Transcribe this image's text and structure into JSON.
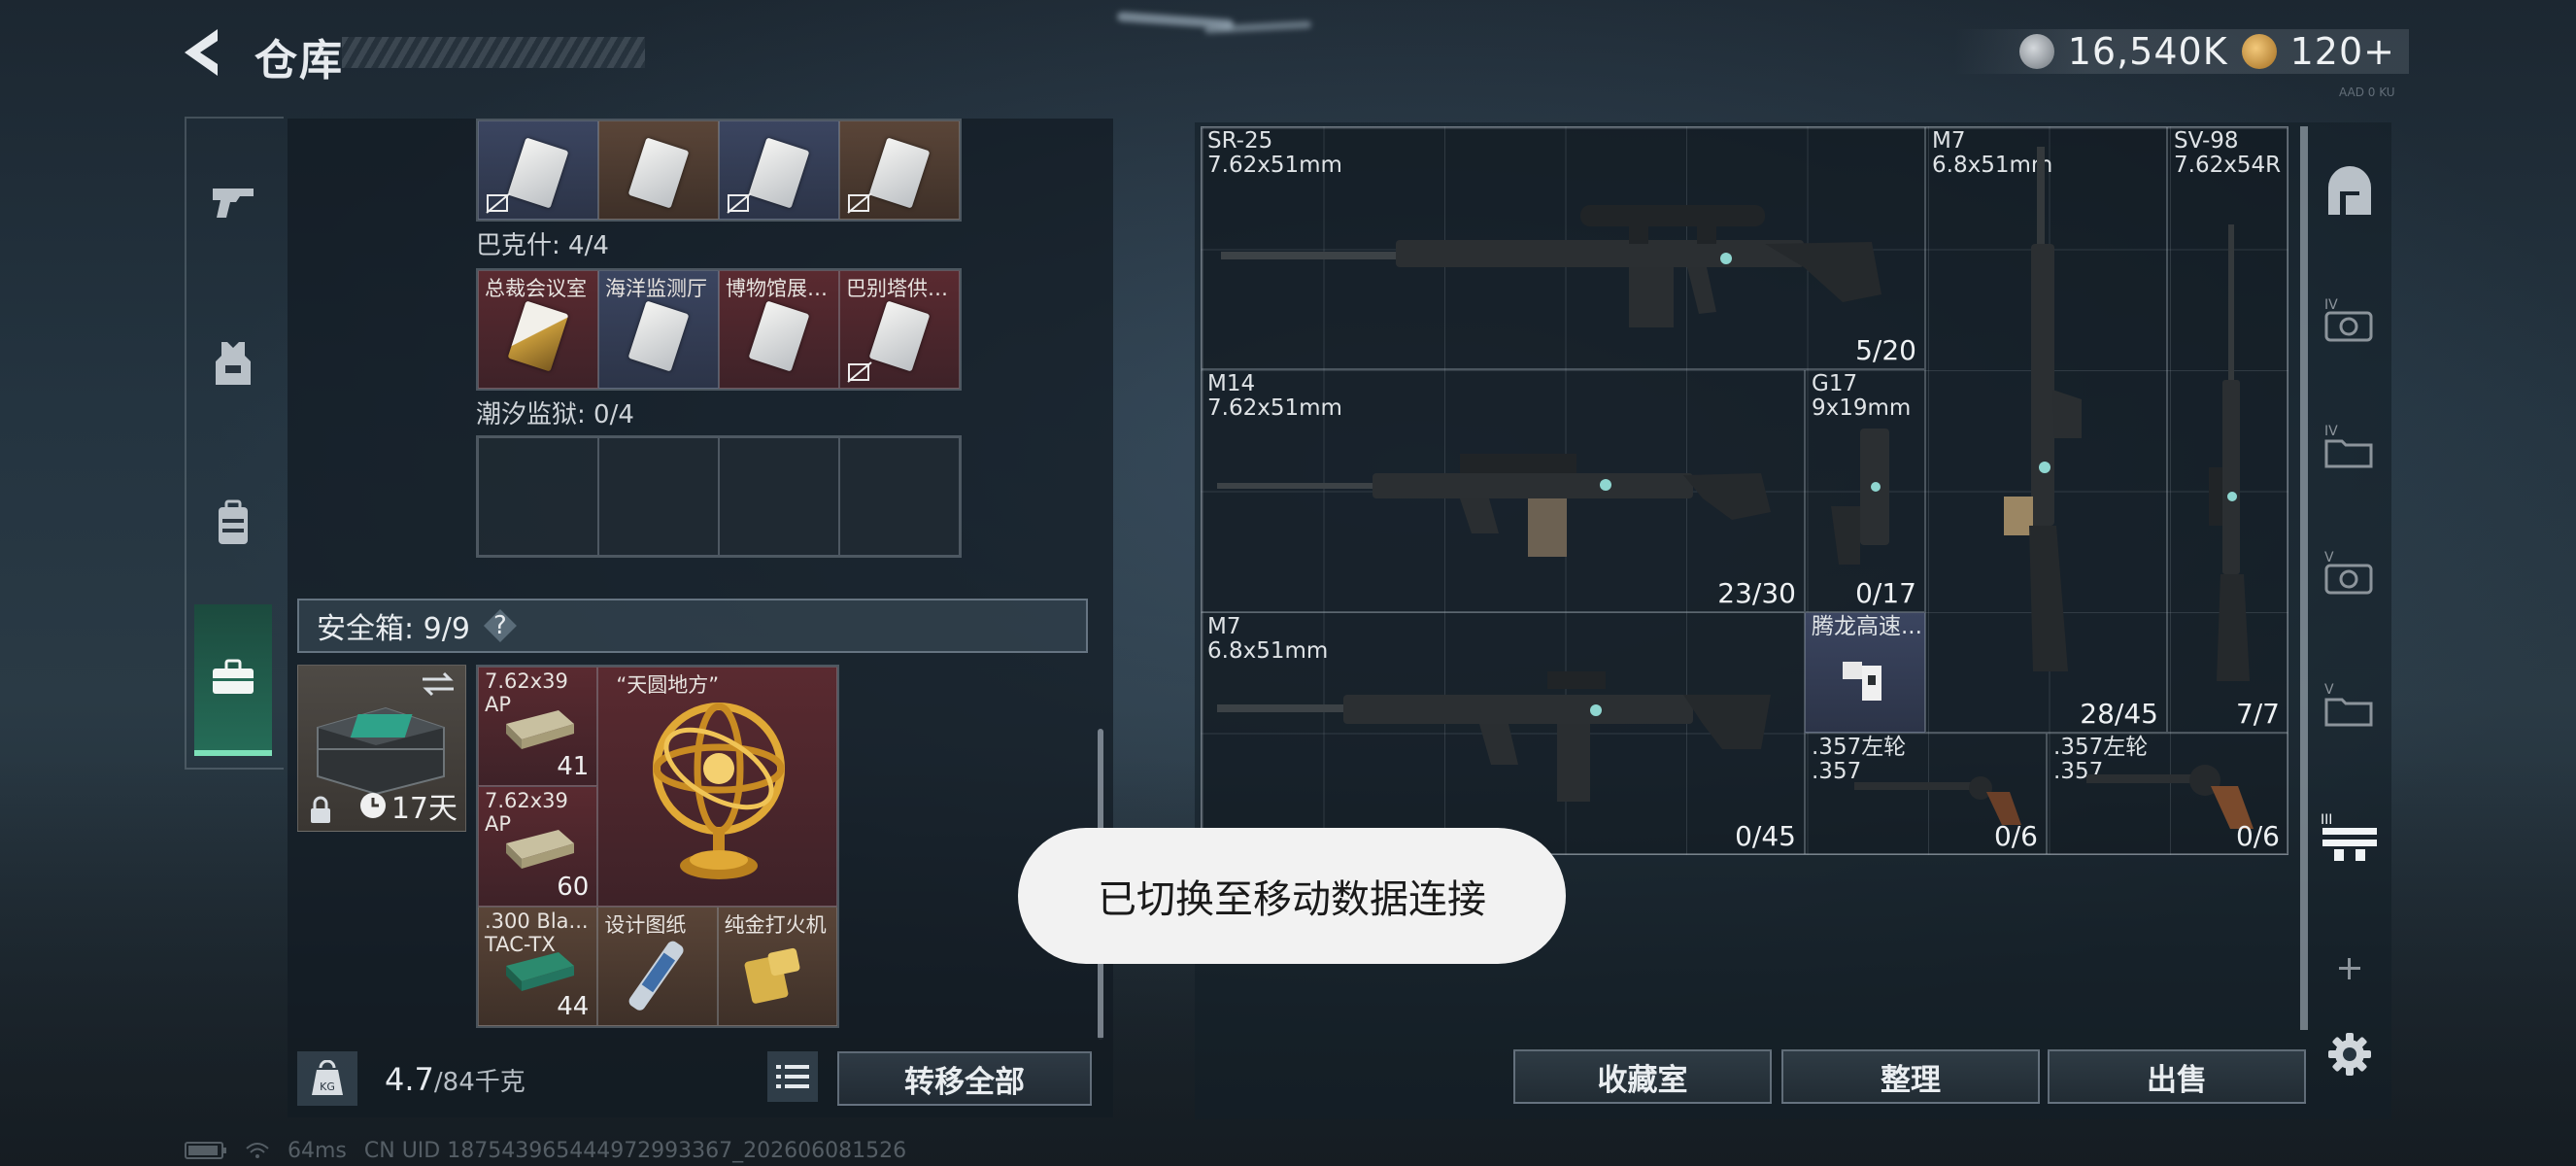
{
  "header": {
    "title": "仓库",
    "currency_silver": "16,540K",
    "currency_gold": "120+",
    "tiny_code": "AAD 0 KU"
  },
  "collection": {
    "row_top_cards": [
      {
        "label": "",
        "color": "blue",
        "nosell": true
      },
      {
        "label": "",
        "color": "brown",
        "nosell": false
      },
      {
        "label": "",
        "color": "blue",
        "nosell": true
      },
      {
        "label": "",
        "color": "brown",
        "nosell": true
      }
    ],
    "set1_label": "巴克什: 4/4",
    "set1_cards": [
      {
        "label": "总裁会议室",
        "color": "red",
        "gold": true,
        "nosell": false
      },
      {
        "label": "海洋监测厅",
        "color": "blue",
        "gold": false,
        "nosell": false
      },
      {
        "label": "博物馆展…",
        "color": "red",
        "gold": false,
        "nosell": false
      },
      {
        "label": "巴别塔供…",
        "color": "red",
        "gold": false,
        "nosell": true
      }
    ],
    "set2_label": "潮汐监狱: 0/4"
  },
  "safe": {
    "header_label": "安全箱: 9/9",
    "help": "?",
    "days_left": "17天",
    "items": [
      {
        "label": "7.62x39\nAP",
        "count": "41"
      },
      {
        "label": "7.62x39\nAP",
        "count": "60"
      },
      {
        "label": "“天圆地方”",
        "count": ""
      },
      {
        "label": ".300 Bla...\nTAC-TX",
        "count": "44"
      },
      {
        "label": "设计图纸",
        "count": ""
      },
      {
        "label": "纯金打火机",
        "count": ""
      }
    ]
  },
  "footer_left": {
    "weight_current": "4.7",
    "weight_max": "/84千克",
    "transfer_all": "转移全部"
  },
  "weapons": [
    {
      "name": "SR-25\n7.62x51mm",
      "ammo": "5/20"
    },
    {
      "name": "M7\n6.8x51mm",
      "ammo": "28/45"
    },
    {
      "name": "SV-98\n7.62x54R",
      "ammo": "7/7"
    },
    {
      "name": "M14\n7.62x51mm",
      "ammo": "23/30"
    },
    {
      "name": "G17\n9x19mm",
      "ammo": "0/17"
    },
    {
      "name": "M7\n6.8x51mm",
      "ammo": "0/45"
    },
    {
      "name": "腾龙高速...",
      "ammo": ""
    },
    {
      "name": ".357左轮\n.357",
      "ammo": "0/6"
    },
    {
      "name": ".357左轮\n.357",
      "ammo": "0/6"
    }
  ],
  "footer_right": {
    "collection_room": "收藏室",
    "sort": "整理",
    "sell": "出售"
  },
  "toast": "已切换至移动数据连接",
  "status": {
    "ping": "64ms",
    "uid": "CN UID 187543965444972993367_202606081526"
  },
  "colors": {
    "accent_green": "#7de0b8",
    "card_red": "#5a2a30",
    "card_blue": "#3b4560"
  }
}
